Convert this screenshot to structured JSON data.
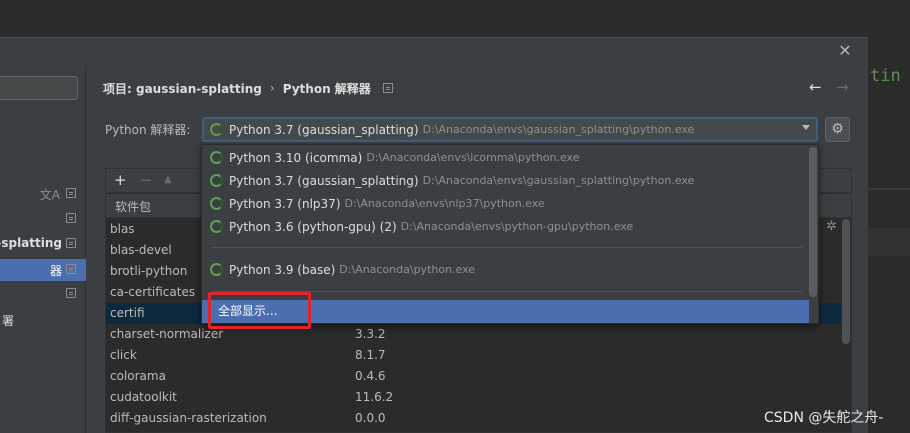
{
  "background": {
    "code_text": "tin"
  },
  "dialog": {
    "close_symbol": "✕",
    "breadcrumb": {
      "project": "项目: gaussian-splatting",
      "separator": "›",
      "page": "Python 解释器"
    },
    "nav": {
      "back": "←",
      "forward": "→"
    }
  },
  "sidebar": {
    "items": [
      {
        "label": "",
        "selected": false
      },
      {
        "label": "",
        "selected": false
      },
      {
        "label": "n-splatting",
        "selected": false
      },
      {
        "label": "器",
        "selected": true
      },
      {
        "label": "",
        "selected": false
      },
      {
        "label": "署",
        "selected": false
      }
    ],
    "translate_icon": "文A"
  },
  "interpreter": {
    "label": "Python 解释器:",
    "selected_name": "Python 3.7 (gaussian_splatting)",
    "selected_path": "D:\\Anaconda\\envs\\gaussian_splatting\\python.exe",
    "gear": "⚙"
  },
  "dropdown": {
    "items": [
      {
        "name": "Python 3.10 (icomma)",
        "path": "D:\\Anaconda\\envs\\icomma\\python.exe"
      },
      {
        "name": "Python 3.7 (gaussian_splatting)",
        "path": "D:\\Anaconda\\envs\\gaussian_splatting\\python.exe"
      },
      {
        "name": "Python 3.7 (nlp37)",
        "path": "D:\\Anaconda\\envs\\nlp37\\python.exe"
      },
      {
        "name": "Python 3.6 (python-gpu) (2)",
        "path": "D:\\Anaconda\\envs\\python-gpu\\python.exe"
      },
      {
        "name": "Python 3.9 (base)",
        "path": "D:\\Anaconda\\python.exe"
      }
    ],
    "show_all": "全部显示..."
  },
  "packages": {
    "toolbar": {
      "add": "+",
      "remove": "−",
      "up": "▲"
    },
    "header": "软件包",
    "rows": [
      {
        "name": "blas",
        "version": ""
      },
      {
        "name": "blas-devel",
        "version": ""
      },
      {
        "name": "brotli-python",
        "version": ""
      },
      {
        "name": "ca-certificates",
        "version": ""
      },
      {
        "name": "certifi",
        "version": ""
      },
      {
        "name": "charset-normalizer",
        "version": "3.3.2"
      },
      {
        "name": "click",
        "version": "8.1.7"
      },
      {
        "name": "colorama",
        "version": "0.4.6"
      },
      {
        "name": "cudatoolkit",
        "version": "11.6.2"
      },
      {
        "name": "diff-gaussian-rasterization",
        "version": "0.0.0"
      }
    ],
    "selected_row": 4
  },
  "watermark": "CSDN @失舵之舟-"
}
